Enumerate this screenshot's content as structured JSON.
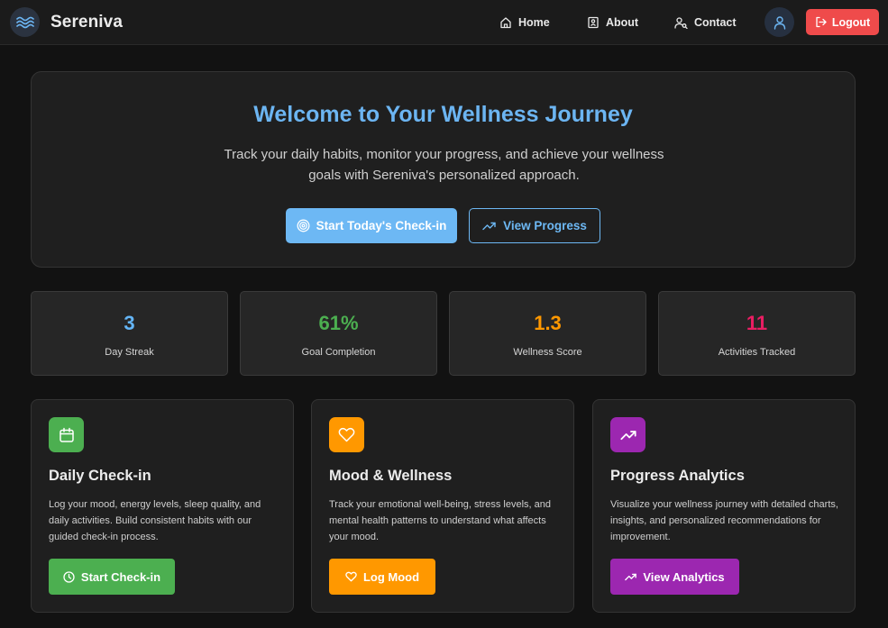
{
  "nav": {
    "brand": "Sereniva",
    "logo_icon": "waves-icon",
    "links": [
      {
        "label": "Home",
        "icon": "home-icon"
      },
      {
        "label": "About",
        "icon": "about-icon"
      },
      {
        "label": "Contact",
        "icon": "contact-icon"
      }
    ],
    "user_icon": "user-icon",
    "logout_label": "Logout"
  },
  "hero": {
    "title": "Welcome to Your Wellness Journey",
    "subtitle": "Track your daily habits, monitor your progress, and achieve your wellness goals with Sereniva's personalized approach.",
    "primary_button": "Start Today's Check-in",
    "secondary_button": "View Progress"
  },
  "stats": [
    {
      "value": "3",
      "label": "Day Streak",
      "color": "#64b5f6"
    },
    {
      "value": "61%",
      "label": "Goal Completion",
      "color": "#4caf50"
    },
    {
      "value": "1.3",
      "label": "Wellness Score",
      "color": "#ff9800"
    },
    {
      "value": "11",
      "label": "Activities Tracked",
      "color": "#e91e63"
    }
  ],
  "cards": [
    {
      "title": "Daily Check-in",
      "description": "Log your mood, energy levels, sleep quality, and daily activities. Build consistent habits with our guided check-in process.",
      "button": "Start Check-in",
      "icon": "calendar-icon",
      "color": "#4caf50"
    },
    {
      "title": "Mood & Wellness",
      "description": "Track your emotional well-being, stress levels, and mental health patterns to understand what affects your mood.",
      "button": "Log Mood",
      "icon": "heart-icon",
      "color": "#ff9800"
    },
    {
      "title": "Progress Analytics",
      "description": "Visualize your wellness journey with detailed charts, insights, and personalized recommendations for improvement.",
      "button": "View Analytics",
      "icon": "trending-up-icon",
      "color": "#9c27b0"
    }
  ]
}
